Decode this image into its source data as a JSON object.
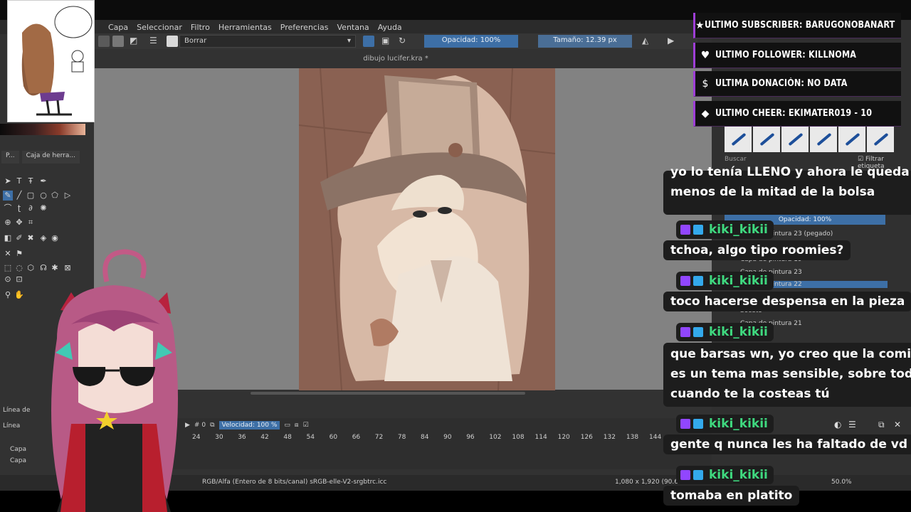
{
  "menu": [
    "Capa",
    "Seleccionar",
    "Filtro",
    "Herramientas",
    "Preferencias",
    "Ventana",
    "Ayuda"
  ],
  "toolbar": {
    "brush_name": "Borrar",
    "opacity": "Opacidad: 100%",
    "size": "Tamaño: 12.39 px"
  },
  "document": {
    "title": "dibujo lucifer.kra *"
  },
  "left_panel": {
    "tab_short": "P...",
    "tab_tools": "Caja de herra...",
    "line_label_1": "Línea de",
    "line_label_2": "Línea",
    "capa_1": "Capa",
    "capa_2": "Capa"
  },
  "timeline": {
    "frame": "0",
    "speed_label": "Velocidad:",
    "speed_value": "100 %",
    "ruler": [
      "24",
      "30",
      "36",
      "42",
      "48",
      "54",
      "60",
      "66",
      "72",
      "78",
      "84",
      "90",
      "96",
      "102",
      "108",
      "114",
      "120",
      "126",
      "132",
      "138",
      "144"
    ]
  },
  "status": {
    "color_info": "RGB/Alfa (Entero de 8 bits/canal)  sRGB-elle-V2-srgbtrc.icc",
    "dimensions": "1,080 x 1,920 (90.6",
    "zoom": "50.0%"
  },
  "right_panel": {
    "search_placeholder": "Buscar",
    "filter_label": "Filtrar etiqueta",
    "layers_opacity": "Opacidad: 100%",
    "layers": [
      "Capa de pintura 23 (pegado)",
      "Capa de pintura 19",
      "Capa de pintura 23",
      "Capa de pintura 22",
      "boceto",
      "Capa de pintura 21"
    ]
  },
  "alerts": [
    {
      "icon": "star-icon",
      "glyph": "★",
      "text": "ULTIMO SUBSCRIBER: BARUGONOBANART"
    },
    {
      "icon": "heart-icon",
      "glyph": "♥",
      "text": "ULTIMO FOLLOWER: KILLNOMA"
    },
    {
      "icon": "dollar-icon",
      "glyph": "$",
      "text": "ULTIMA DONACIÓN: NO DATA"
    },
    {
      "icon": "diamond-icon",
      "glyph": "◆",
      "text": "ULTIMO CHEER: EKIMATER019 - 10"
    }
  ],
  "chat": {
    "partial_line_1": "yo lo tenía LLENO y ahora le queda",
    "partial_line_2": "menos de la mitad de la bolsa",
    "messages": [
      {
        "user": "kiki_kikii",
        "lines": [
          "tchoa, algo tipo roomies?"
        ]
      },
      {
        "user": "kiki_kikii",
        "lines": [
          "toco hacerse despensa en la pieza"
        ]
      },
      {
        "user": "kiki_kikii",
        "lines": [
          "que barsas wn, yo creo que la comida",
          "es un tema mas sensible, sobre todo",
          "cuando te la costeas tú"
        ]
      },
      {
        "user": "kiki_kikii",
        "lines": [
          "gente q nunca les ha faltado de vd"
        ]
      },
      {
        "user": "kiki_kikii",
        "lines": [
          "tomaba en platito"
        ]
      }
    ]
  },
  "colors": {
    "accent_blue": "#3d6fa6",
    "chat_name": "#3fd97f",
    "alert_border": "#9e3ed6",
    "artwork_bg": "#8a6152"
  }
}
